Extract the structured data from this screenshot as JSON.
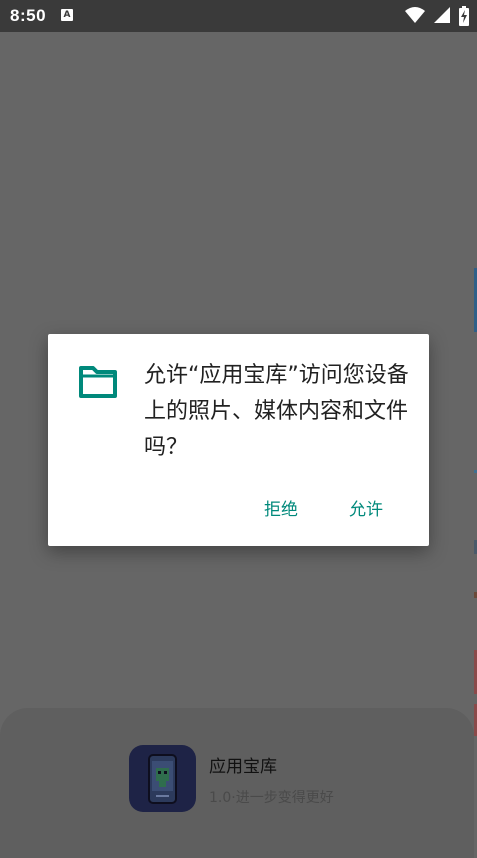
{
  "status_bar": {
    "time": "8:50",
    "notification_glyph": "A",
    "icons": [
      "wifi-icon",
      "signal-icon",
      "battery-charging-icon"
    ]
  },
  "bottom_sheet": {
    "app_name": "应用宝库",
    "app_subtitle": "1.0·进一步变得更好",
    "icon": "app-logo-icon"
  },
  "dialog": {
    "icon": "folder-icon",
    "message": "允许“应用宝库”访问您设备上的照片、媒体内容和文件吗？",
    "deny_label": "拒绝",
    "allow_label": "允许",
    "accent_color": "#00897b"
  }
}
